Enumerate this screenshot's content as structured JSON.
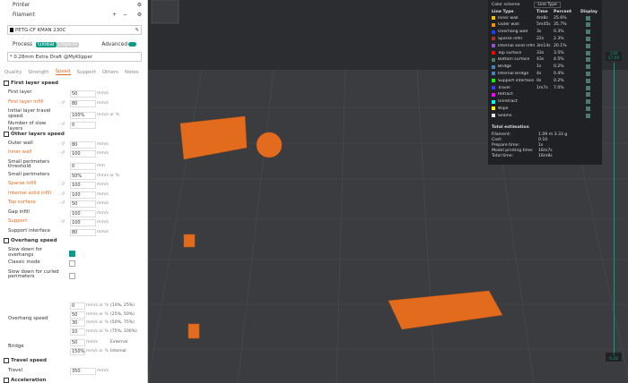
{
  "printer": {
    "label": "Printer",
    "filament_label": "Filament",
    "filament_value": "PETG-CF KMAN 230C"
  },
  "process": {
    "label": "Process",
    "global": "Global",
    "objects": "Objects",
    "advanced": "Advanced",
    "profile": "* 0.28mm Extra Draft @MyKlipper"
  },
  "tabs": [
    "Quality",
    "Strength",
    "Speed",
    "Support",
    "Others",
    "Notes"
  ],
  "settings": [
    {
      "type": "section",
      "label": "First layer speed"
    },
    {
      "label": "First layer",
      "value": "50",
      "unit": "mm/s"
    },
    {
      "label": "First layer infill",
      "value": "80",
      "unit": "mm/s",
      "orange": true,
      "reset": true
    },
    {
      "label": "Initial layer travel speed",
      "value": "100%",
      "unit": "mm/s or %"
    },
    {
      "label": "Number of slow layers",
      "value": "0",
      "reset": true
    },
    {
      "type": "section",
      "label": "Other layers speed"
    },
    {
      "label": "Outer wall",
      "value": "80",
      "unit": "mm/s",
      "reset": true
    },
    {
      "label": "Inner wall",
      "value": "100",
      "unit": "mm/s",
      "orange": true,
      "reset": true
    },
    {
      "label": "Small perimeters threshold",
      "value": "0",
      "unit": "mm"
    },
    {
      "label": "Small perimeters",
      "value": "50%",
      "unit": "mm/s or %"
    },
    {
      "label": "Sparse infill",
      "value": "100",
      "unit": "mm/s",
      "orange": true,
      "reset": true
    },
    {
      "label": "Internal solid infill",
      "value": "100",
      "unit": "mm/s",
      "orange": true,
      "reset": true
    },
    {
      "label": "Top surface",
      "value": "50",
      "unit": "mm/s",
      "orange": true,
      "reset": true
    },
    {
      "label": "Gap infill",
      "value": "100",
      "unit": "mm/s"
    },
    {
      "label": "Support",
      "value": "100",
      "unit": "mm/s",
      "orange": true,
      "reset": true
    },
    {
      "label": "Support interface",
      "value": "80",
      "unit": "mm/s"
    },
    {
      "type": "section",
      "label": "Overhang speed"
    },
    {
      "label": "Slow down for overhangs",
      "check": true
    },
    {
      "label": "Classic mode",
      "check": false
    },
    {
      "label": "Slow down for curled perimeters",
      "check": false
    }
  ],
  "overhang": {
    "label": "Overhang speed",
    "rows": [
      {
        "value": "0",
        "unit": "mm/s or %",
        "range": "(10%, 25%)"
      },
      {
        "value": "50",
        "unit": "mm/s or %",
        "range": "(25%, 50%)"
      },
      {
        "value": "30",
        "unit": "mm/s or %",
        "range": "(50%, 75%)"
      },
      {
        "value": "10",
        "unit": "mm/s or %",
        "range": "(75%, 100%)"
      }
    ]
  },
  "bridge": {
    "label": "Bridge",
    "external": "50",
    "external_label": "External",
    "internal": "150%",
    "internal_label": "Internal",
    "unit1": "mm/s",
    "unit2": "mm/s or %"
  },
  "travel": {
    "section": "Travel speed",
    "label": "Travel",
    "value": "350",
    "unit": "mm/s"
  },
  "accel": {
    "section": "Acceleration"
  },
  "legend": {
    "title": "Color scheme",
    "scheme": "Line Type",
    "headers": [
      "Line Type",
      "Time",
      "Percent",
      "Display"
    ],
    "rows": [
      {
        "name": "Inner wall",
        "time": "4m8s",
        "pct": "25.6%",
        "color": "#f5c400"
      },
      {
        "name": "Outer wall",
        "time": "5m45s",
        "pct": "35.7%",
        "color": "#ff8c00"
      },
      {
        "name": "Overhang wall",
        "time": "3s",
        "pct": "0.3%",
        "color": "#1f3fff"
      },
      {
        "name": "Sparse infill",
        "time": "22s",
        "pct": "2.3%",
        "color": "#b03029"
      },
      {
        "name": "Internal solid infill",
        "time": "3m14s",
        "pct": "20.1%",
        "color": "#9654cc"
      },
      {
        "name": "Top surface",
        "time": "33s",
        "pct": "3.5%",
        "color": "#ff0000"
      },
      {
        "name": "Bottom surface",
        "time": "43s",
        "pct": "4.5%",
        "color": "#4d8066"
      },
      {
        "name": "Bridge",
        "time": "1s",
        "pct": "0.2%",
        "color": "#4d80ba"
      },
      {
        "name": "Internal Bridge",
        "time": "4s",
        "pct": "0.4%",
        "color": "#4d80ba"
      },
      {
        "name": "Support interface",
        "time": "0s",
        "pct": "0.2%",
        "color": "#00ff00"
      },
      {
        "name": "Travel",
        "time": "1m7s",
        "pct": "7.0%",
        "color": "#3a3aff"
      },
      {
        "name": "Retract",
        "time": "",
        "pct": "",
        "color": "#ff00ff"
      },
      {
        "name": "Unretract",
        "time": "",
        "pct": "",
        "color": "#00ffff"
      },
      {
        "name": "Wipe",
        "time": "",
        "pct": "",
        "color": "#ffff00"
      },
      {
        "name": "Seams",
        "time": "",
        "pct": "",
        "color": "#e6e6e6"
      }
    ],
    "total_title": "Total estimation",
    "totals": [
      {
        "k": "Filament:",
        "v": "1.09 m     3.33 g"
      },
      {
        "k": "Cost:",
        "v": "0.10"
      },
      {
        "k": "Prepare time:",
        "v": "1s"
      },
      {
        "k": "Model printing time:",
        "v": "16m7s"
      },
      {
        "k": "Total time:",
        "v": "16m8s"
      }
    ]
  },
  "slider": {
    "top": "116",
    "top2": "17.00",
    "bottom": "1",
    "bottom2": "0.28"
  },
  "colors": {
    "model": "#e36b1e",
    "accent": "#0a9d8a"
  }
}
